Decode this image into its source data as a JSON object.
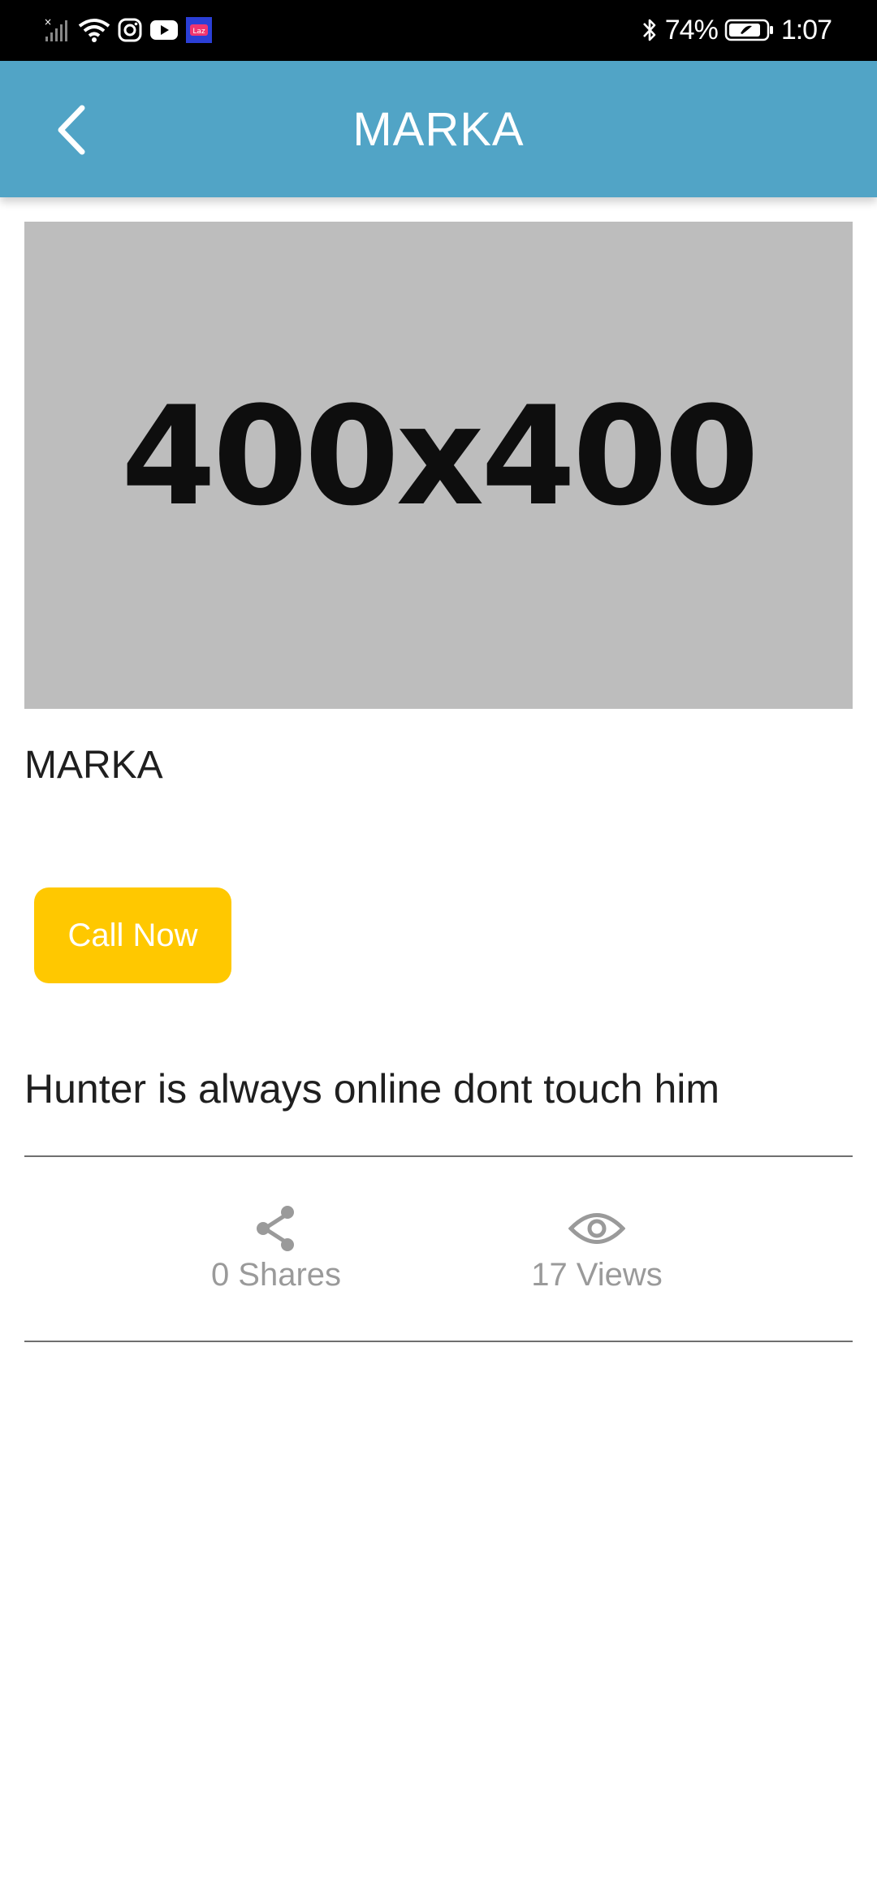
{
  "status_bar": {
    "battery_percent": "74%",
    "time": "1:07",
    "icons": [
      "no-signal-icon",
      "wifi-icon",
      "instagram-icon",
      "youtube-icon",
      "lazada-icon",
      "bluetooth-icon",
      "battery-icon"
    ]
  },
  "app_bar": {
    "title": "MARKA",
    "background": "#51a4c6"
  },
  "listing": {
    "image_placeholder_text": "400x400",
    "title": "MARKA",
    "call_button_label": "Call Now",
    "call_button_color": "#ffc800",
    "description": "Hunter is always online dont touch him"
  },
  "stats": {
    "shares_label": "0 Shares",
    "views_label": "17 Views"
  }
}
